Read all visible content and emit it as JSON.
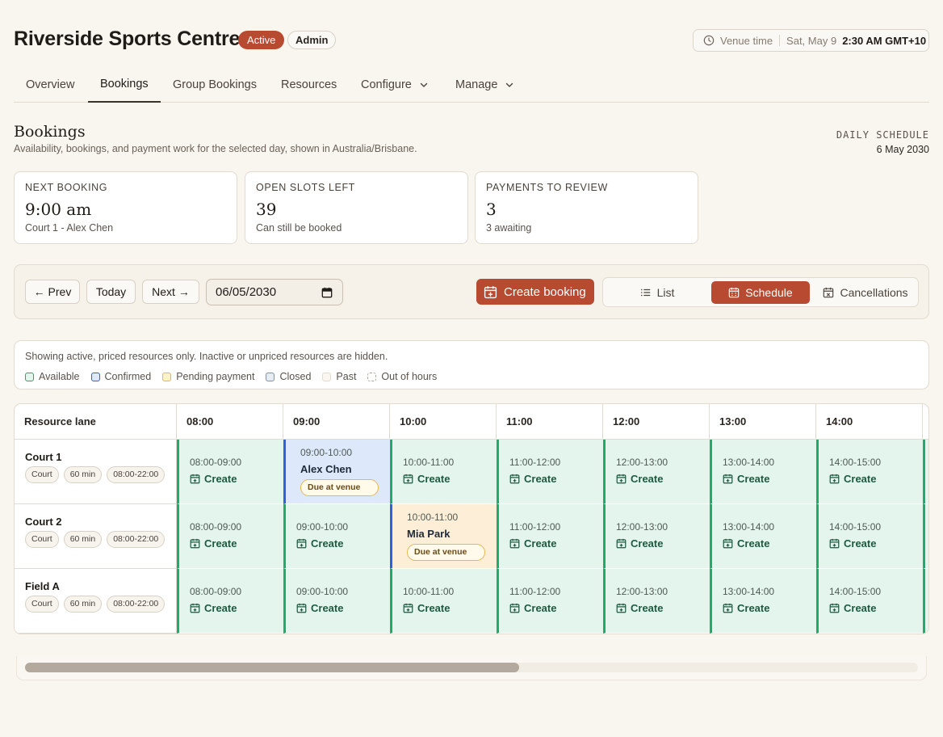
{
  "header": {
    "venue_name": "Riverside Sports Centre",
    "status_badge": "Active",
    "role_badge": "Admin",
    "venue_time_label": "Venue time",
    "venue_date": "Sat, May 9",
    "venue_time": "2:30 AM GMT+10"
  },
  "tabs": [
    {
      "label": "Overview"
    },
    {
      "label": "Bookings"
    },
    {
      "label": "Group Bookings"
    },
    {
      "label": "Resources"
    },
    {
      "label": "Configure"
    },
    {
      "label": "Manage"
    }
  ],
  "section": {
    "title": "Bookings",
    "subtitle": "Availability, bookings, and payment work for the selected day, shown in Australia/Brisbane.",
    "schedule_label": "DAILY SCHEDULE",
    "schedule_date": "6 May 2030"
  },
  "stats": [
    {
      "label": "NEXT BOOKING",
      "value": "9:00 am",
      "sub": "Court 1 - Alex Chen"
    },
    {
      "label": "OPEN SLOTS LEFT",
      "value": "39",
      "sub": "Can still be booked"
    },
    {
      "label": "PAYMENTS TO REVIEW",
      "value": "3",
      "sub": "3 awaiting"
    }
  ],
  "toolbar": {
    "prev": "← Prev",
    "today": "Today",
    "next": "Next →",
    "date_value": "06/05/2030",
    "create": "Create booking",
    "views": [
      "List",
      "Schedule",
      "Cancellations"
    ]
  },
  "legend": {
    "note": "Showing active, priced resources only. Inactive or unpriced resources are hidden.",
    "items": [
      {
        "label": "Available",
        "color": "#1fab6b"
      },
      {
        "label": "Confirmed",
        "color": "#2a62e0"
      },
      {
        "label": "Pending payment",
        "color": "#e6b94a"
      },
      {
        "label": "Closed",
        "color": "#7c93a8"
      },
      {
        "label": "Past",
        "color": "#e2dbd0"
      },
      {
        "label": "Out of hours",
        "color": "#b3aa9d"
      }
    ]
  },
  "grid": {
    "lane_header": "Resource lane",
    "hours": [
      "08:00",
      "09:00",
      "10:00",
      "11:00",
      "12:00",
      "13:00",
      "14:00"
    ],
    "resources": [
      {
        "name": "Court 1",
        "tags": [
          "Court",
          "60 min",
          "08:00-22:00"
        ]
      },
      {
        "name": "Court 2",
        "tags": [
          "Court",
          "60 min",
          "08:00-22:00"
        ]
      },
      {
        "name": "Field A",
        "tags": [
          "Court",
          "60 min",
          "08:00-22:00"
        ]
      }
    ],
    "slots": [
      [
        {
          "time": "08:00-09:00",
          "state": "available",
          "action": "Create"
        },
        {
          "time": "09:00-10:00",
          "state": "confirmed",
          "customer": "Alex Chen",
          "payment": "Due at venue"
        },
        {
          "time": "10:00-11:00",
          "state": "available",
          "action": "Create"
        },
        {
          "time": "11:00-12:00",
          "state": "available",
          "action": "Create"
        },
        {
          "time": "12:00-13:00",
          "state": "available",
          "action": "Create"
        },
        {
          "time": "13:00-14:00",
          "state": "available",
          "action": "Create"
        },
        {
          "time": "14:00-15:00",
          "state": "available",
          "action": "Create"
        }
      ],
      [
        {
          "time": "08:00-09:00",
          "state": "available",
          "action": "Create"
        },
        {
          "time": "09:00-10:00",
          "state": "available",
          "action": "Create"
        },
        {
          "time": "10:00-11:00",
          "state": "pending",
          "customer": "Mia Park",
          "payment": "Due at venue"
        },
        {
          "time": "11:00-12:00",
          "state": "available",
          "action": "Create"
        },
        {
          "time": "12:00-13:00",
          "state": "available",
          "action": "Create"
        },
        {
          "time": "13:00-14:00",
          "state": "available",
          "action": "Create"
        },
        {
          "time": "14:00-15:00",
          "state": "available",
          "action": "Create"
        }
      ],
      [
        {
          "time": "08:00-09:00",
          "state": "available",
          "action": "Create"
        },
        {
          "time": "09:00-10:00",
          "state": "available",
          "action": "Create"
        },
        {
          "time": "10:00-11:00",
          "state": "available",
          "action": "Create"
        },
        {
          "time": "11:00-12:00",
          "state": "available",
          "action": "Create"
        },
        {
          "time": "12:00-13:00",
          "state": "available",
          "action": "Create"
        },
        {
          "time": "13:00-14:00",
          "state": "available",
          "action": "Create"
        },
        {
          "time": "14:00-15:00",
          "state": "available",
          "action": "Create"
        }
      ]
    ]
  },
  "scroll": {
    "position": 0.54
  }
}
